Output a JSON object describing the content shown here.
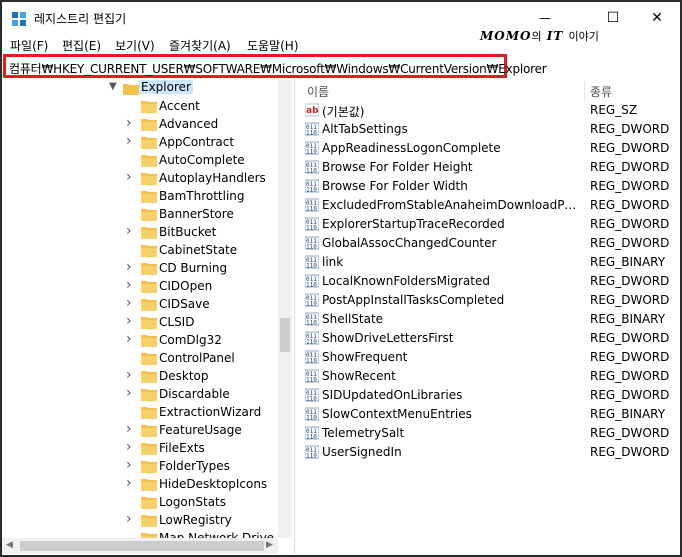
{
  "window": {
    "title": "레지스트리 편집기",
    "brand": "MOMO",
    "brand_sub1": "의",
    "brand_it": "IT",
    "brand_sub2": "이야기",
    "minimize": "—",
    "maximize": "☐",
    "close": "✕"
  },
  "menu": [
    "파일(F)",
    "편집(E)",
    "보기(V)",
    "즐겨찾기(A)",
    "도움말(H)"
  ],
  "address": "컴퓨터₩HKEY_CURRENT_USER₩SOFTWARE₩Microsoft₩Windows₩CurrentVersion₩Explorer",
  "tree": {
    "selected": "Explorer",
    "children": [
      "Accent",
      "Advanced",
      "AppContract",
      "AutoComplete",
      "AutoplayHandlers",
      "BamThrottling",
      "BannerStore",
      "BitBucket",
      "CabinetState",
      "CD Burning",
      "CIDOpen",
      "CIDSave",
      "CLSID",
      "ComDlg32",
      "ControlPanel",
      "Desktop",
      "Discardable",
      "ExtractionWizard",
      "FeatureUsage",
      "FileExts",
      "FolderTypes",
      "HideDesktopIcons",
      "LogonStats",
      "LowRegistry",
      "Map Network Drive M"
    ],
    "has_children": [
      false,
      true,
      true,
      false,
      true,
      false,
      false,
      true,
      false,
      true,
      true,
      true,
      true,
      true,
      false,
      true,
      true,
      false,
      true,
      true,
      true,
      true,
      false,
      true,
      false
    ]
  },
  "list": {
    "col_name": "이름",
    "col_type": "종류",
    "rows": [
      {
        "icon": "string-value-icon",
        "name": "(기본값)",
        "type": "REG_SZ"
      },
      {
        "icon": "binary-value-icon",
        "name": "AltTabSettings",
        "type": "REG_DWORD"
      },
      {
        "icon": "binary-value-icon",
        "name": "AppReadinessLogonComplete",
        "type": "REG_DWORD"
      },
      {
        "icon": "binary-value-icon",
        "name": "Browse For Folder Height",
        "type": "REG_DWORD"
      },
      {
        "icon": "binary-value-icon",
        "name": "Browse For Folder Width",
        "type": "REG_DWORD"
      },
      {
        "icon": "binary-value-icon",
        "name": "ExcludedFromStableAnaheimDownloadPromo...",
        "type": "REG_DWORD"
      },
      {
        "icon": "binary-value-icon",
        "name": "ExplorerStartupTraceRecorded",
        "type": "REG_DWORD"
      },
      {
        "icon": "binary-value-icon",
        "name": "GlobalAssocChangedCounter",
        "type": "REG_DWORD"
      },
      {
        "icon": "binary-value-icon",
        "name": "link",
        "type": "REG_BINARY"
      },
      {
        "icon": "binary-value-icon",
        "name": "LocalKnownFoldersMigrated",
        "type": "REG_DWORD"
      },
      {
        "icon": "binary-value-icon",
        "name": "PostAppInstallTasksCompleted",
        "type": "REG_DWORD"
      },
      {
        "icon": "binary-value-icon",
        "name": "ShellState",
        "type": "REG_BINARY"
      },
      {
        "icon": "binary-value-icon",
        "name": "ShowDriveLettersFirst",
        "type": "REG_DWORD"
      },
      {
        "icon": "binary-value-icon",
        "name": "ShowFrequent",
        "type": "REG_DWORD"
      },
      {
        "icon": "binary-value-icon",
        "name": "ShowRecent",
        "type": "REG_DWORD"
      },
      {
        "icon": "binary-value-icon",
        "name": "SIDUpdatedOnLibraries",
        "type": "REG_DWORD"
      },
      {
        "icon": "binary-value-icon",
        "name": "SlowContextMenuEntries",
        "type": "REG_BINARY"
      },
      {
        "icon": "binary-value-icon",
        "name": "TelemetrySalt",
        "type": "REG_DWORD"
      },
      {
        "icon": "binary-value-icon",
        "name": "UserSignedIn",
        "type": "REG_DWORD"
      }
    ]
  },
  "colors": {
    "highlight_border": "#e8191f",
    "folder": "#f2c24a",
    "selected_bg": "#cce8ff"
  }
}
